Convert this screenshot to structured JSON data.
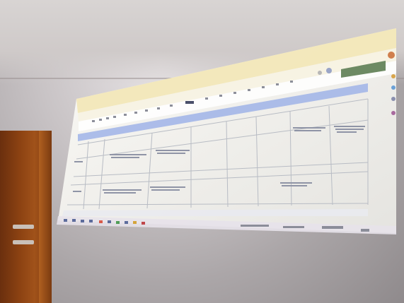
{
  "scene": {
    "description_free": true
  },
  "projection": {
    "app": "spreadsheet",
    "colors": {
      "toolbar": "#f4e6b0",
      "sheet_bg": "#f2f2ee",
      "header_band": "#9fb3e8",
      "grid_line": "#b8bcc4",
      "share_button": "#6d8a63",
      "taskbar": "#e7e2ea"
    },
    "icons": [
      "search-icon",
      "share-icon",
      "comment-icon",
      "menu-icon"
    ]
  }
}
